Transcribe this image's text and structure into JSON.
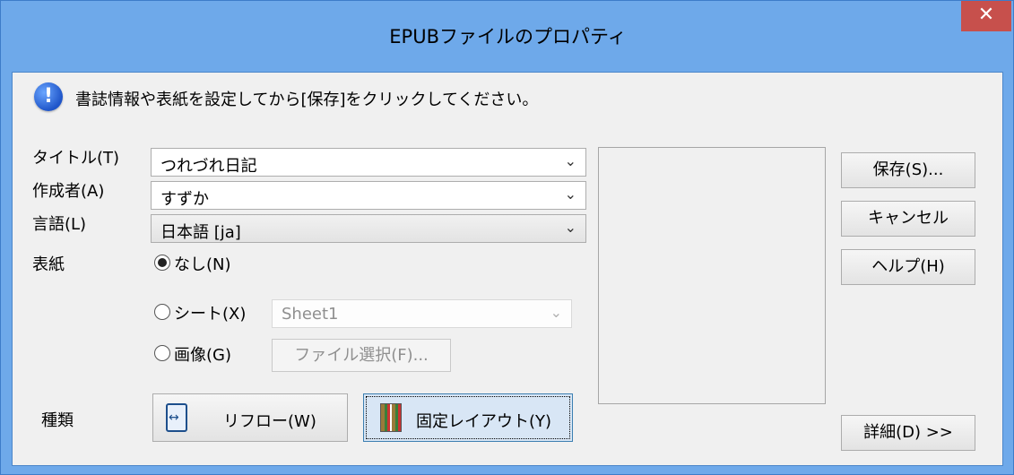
{
  "window": {
    "title": "EPUBファイルのプロパティ",
    "close_label": "✕"
  },
  "message": {
    "icon": "info-icon",
    "text": "書誌情報や表紙を設定してから[保存]をクリックしてください。"
  },
  "fields": {
    "title_label": "タイトル(T)",
    "title_value": "つれづれ日記",
    "author_label": "作成者(A)",
    "author_value": "すずか",
    "language_label": "言語(L)",
    "language_value": "日本語 [ja]",
    "cover_label": "表紙"
  },
  "cover_options": {
    "none_label": "なし(N)",
    "sheet_label": "シート(X)",
    "sheet_value": "Sheet1",
    "image_label": "画像(G)",
    "choose_file_label": "ファイル選択(F)..."
  },
  "kind": {
    "label": "種類",
    "reflow_label": "リフロー(W)",
    "fixed_label": "固定レイアウト(Y)"
  },
  "buttons": {
    "save": "保存(S)...",
    "cancel": "キャンセル",
    "help": "ヘルプ(H)",
    "details": "詳細(D) >>"
  },
  "colors": {
    "frame": "#6ea9ea",
    "close": "#c7504c",
    "client": "#f0f0f0"
  }
}
